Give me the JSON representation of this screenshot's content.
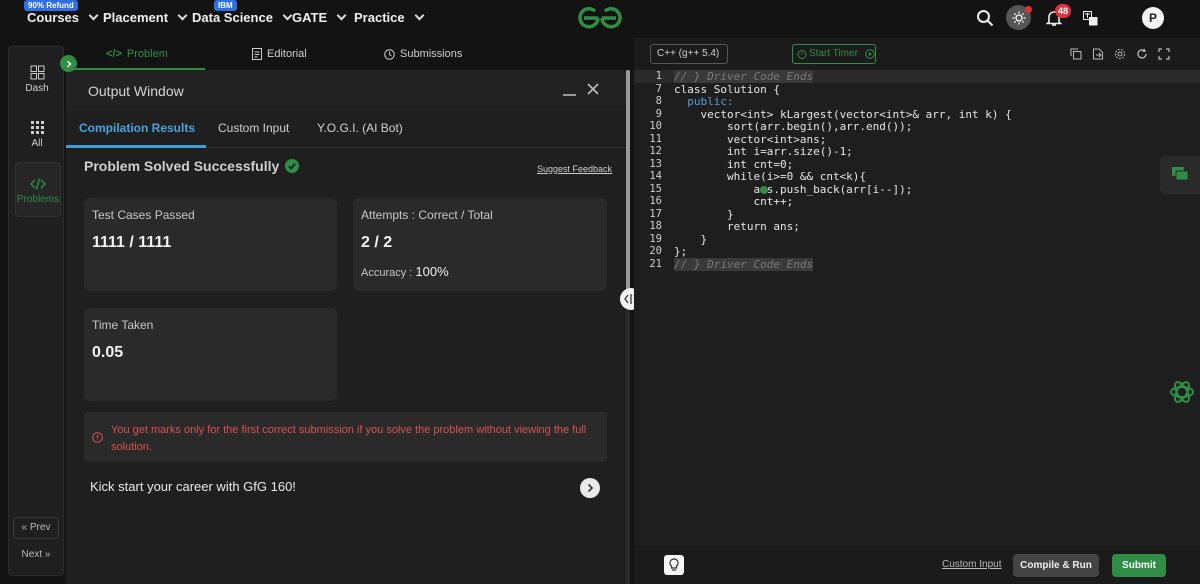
{
  "nav": {
    "items": [
      {
        "label": "Courses",
        "badge": "90% Refund"
      },
      {
        "label": "Placement",
        "badge": ""
      },
      {
        "label": "Data Science",
        "badge": "IBM"
      },
      {
        "label": "GATE",
        "badge": ""
      },
      {
        "label": "Practice",
        "badge": ""
      }
    ],
    "notification_count": "48",
    "avatar_letter": "P"
  },
  "sidebar": {
    "items": [
      {
        "label": "Dash",
        "icon": "dashboard-icon"
      },
      {
        "label": "All",
        "icon": "grid-icon"
      },
      {
        "label": "Problems",
        "icon": "code-icon"
      }
    ],
    "prev": "« Prev",
    "next": "Next »"
  },
  "tabs": {
    "problem": "Problem",
    "editorial": "Editorial",
    "submissions": "Submissions"
  },
  "output": {
    "title": "Output Window",
    "tabs": [
      "Compilation Results",
      "Custom Input",
      "Y.O.G.I. (AI Bot)"
    ],
    "solved": "Problem Solved Successfully",
    "feedback": "Suggest Feedback",
    "test_cases_label": "Test Cases Passed",
    "test_cases_value": "1111 / 1111",
    "attempts_label": "Attempts : Correct / Total",
    "attempts_value": "2 / 2",
    "accuracy_label": "Accuracy :",
    "accuracy_value": "100%",
    "time_label": "Time Taken",
    "time_value": "0.05",
    "warning": "You get marks only for the first correct submission if you solve the problem without viewing the full solution.",
    "kickstart": "Kick start your career with GfG 160!"
  },
  "editor": {
    "language": "C++ (g++ 5.4)",
    "timer": "Start Timer",
    "custom_input": "Custom Input",
    "compile_run": "Compile & Run",
    "submit": "Submit",
    "lines": [
      {
        "n": "1",
        "code": "// } Driver Code Ends"
      },
      {
        "n": "7",
        "code": "class Solution {"
      },
      {
        "n": "8",
        "code": "  public:"
      },
      {
        "n": "9",
        "code": "    vector<int> kLargest(vector<int>& arr, int k) {"
      },
      {
        "n": "10",
        "code": "        sort(arr.begin(),arr.end());"
      },
      {
        "n": "11",
        "code": "        vector<int>ans;"
      },
      {
        "n": "12",
        "code": "        int i=arr.size()-1;"
      },
      {
        "n": "13",
        "code": "        int cnt=0;"
      },
      {
        "n": "14",
        "code": "        while(i>=0 && cnt<k){"
      },
      {
        "n": "15",
        "code": "            ans.push_back(arr[i--]);"
      },
      {
        "n": "16",
        "code": "            cnt++;"
      },
      {
        "n": "17",
        "code": "        }"
      },
      {
        "n": "18",
        "code": "        return ans;"
      },
      {
        "n": "19",
        "code": "    }"
      },
      {
        "n": "20",
        "code": "};"
      },
      {
        "n": "21",
        "code": "// } Driver Code Ends"
      }
    ]
  },
  "colors": {
    "brand_green": "#2f8d46",
    "tab_blue": "#3e9fd8",
    "warning_red": "#d9534f",
    "notification_red": "#e0313a"
  }
}
